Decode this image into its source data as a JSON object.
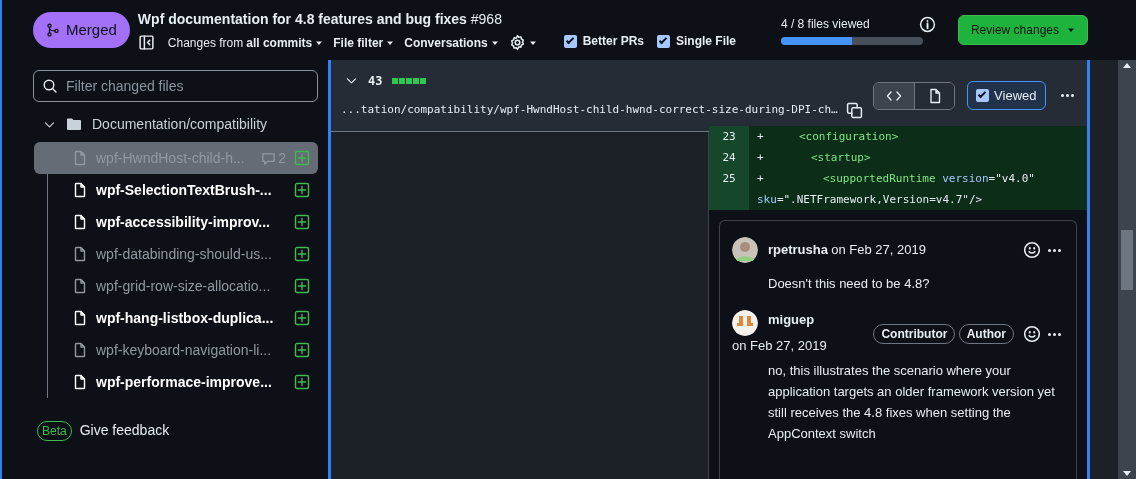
{
  "header": {
    "state": "Merged",
    "title": "Wpf documentation for 4.8 features and bug fixes",
    "number": "#968",
    "menus": [
      {
        "kind": "commits",
        "prefix": "Changes from ",
        "label": "all commits"
      },
      {
        "kind": "plain",
        "label": "File filter"
      },
      {
        "kind": "plain",
        "label": "Conversations"
      },
      {
        "kind": "gear"
      }
    ],
    "toggles": [
      {
        "label": "Better PRs",
        "checked": true
      },
      {
        "label": "Single File",
        "checked": true
      }
    ],
    "progress": {
      "label": "4 / 8 files viewed",
      "level": 0.5
    },
    "review_button": "Review changes"
  },
  "sidebar": {
    "filter_placeholder": "Filter changed files",
    "folder": {
      "name": "Documentation/compatibility",
      "expanded": true,
      "children": [
        {
          "name": "wpf-HwndHost-child-h...",
          "viewed": true,
          "selected": true,
          "comments": "2"
        },
        {
          "name": "wpf-SelectionTextBrush-...",
          "viewed": false,
          "selected": false
        },
        {
          "name": "wpf-accessibility-improv...",
          "viewed": false,
          "selected": false
        },
        {
          "name": "wpf-databinding-should-us...",
          "viewed": true,
          "selected": false
        },
        {
          "name": "wpf-grid-row-size-allocatio...",
          "viewed": true,
          "selected": false
        },
        {
          "name": "wpf-hang-listbox-duplica...",
          "viewed": false,
          "selected": false
        },
        {
          "name": "wpf-keyboard-navigation-li...",
          "viewed": true,
          "selected": false
        },
        {
          "name": "wpf-performace-improve...",
          "viewed": false,
          "selected": false
        }
      ]
    },
    "feedback": {
      "badge": "Beta",
      "label": "Give feedback"
    }
  },
  "file": {
    "expanded": true,
    "additions": "43",
    "diffstat": [
      {
        "kind": "added"
      },
      {
        "kind": "added"
      },
      {
        "kind": "added"
      },
      {
        "kind": "added"
      },
      {
        "kind": "added"
      }
    ],
    "path": "...tation/compatibility/wpf-HwndHost-child-hwnd-correct-size-during-DPI-ch…",
    "views": [
      {
        "kind": "code",
        "selected": true
      },
      {
        "kind": "file",
        "selected": false
      }
    ],
    "viewed": {
      "label": "Viewed",
      "checked": true
    },
    "lines": [
      {
        "number": "23",
        "sign": "+",
        "tokens": [
          {
            "kind": "tag",
            "text": "<configuration>"
          }
        ]
      },
      {
        "number": "24",
        "sign": "+",
        "tokens": [
          {
            "kind": "tag",
            "text": "<startup>"
          }
        ]
      },
      {
        "number": "25",
        "sign": "+",
        "tokens": [
          {
            "kind": "tag",
            "text": "<supportedRuntime"
          },
          {
            "kind": "attr",
            "text": " version"
          },
          {
            "kind": "plain",
            "text": "=\"v4.0\""
          },
          {
            "kind": "break"
          },
          {
            "kind": "attr",
            "text": "sku"
          },
          {
            "kind": "plain",
            "text": "=\".NETFramework,Version=v4.7\"/>"
          }
        ]
      }
    ],
    "comments": [
      {
        "author": "rpetrusha",
        "date": "on Feb 27, 2019",
        "body": "Doesn't this need to be 4.8?",
        "kind": "photo"
      },
      {
        "author": "miguep",
        "date": "on Feb 27, 2019",
        "badges": [
          "Contributor",
          "Author"
        ],
        "body": "no, this illustrates the scenario where your application targets an older framework version yet still receives the 4.8 fixes when setting the AppContext switch",
        "kind": "logo"
      }
    ]
  }
}
